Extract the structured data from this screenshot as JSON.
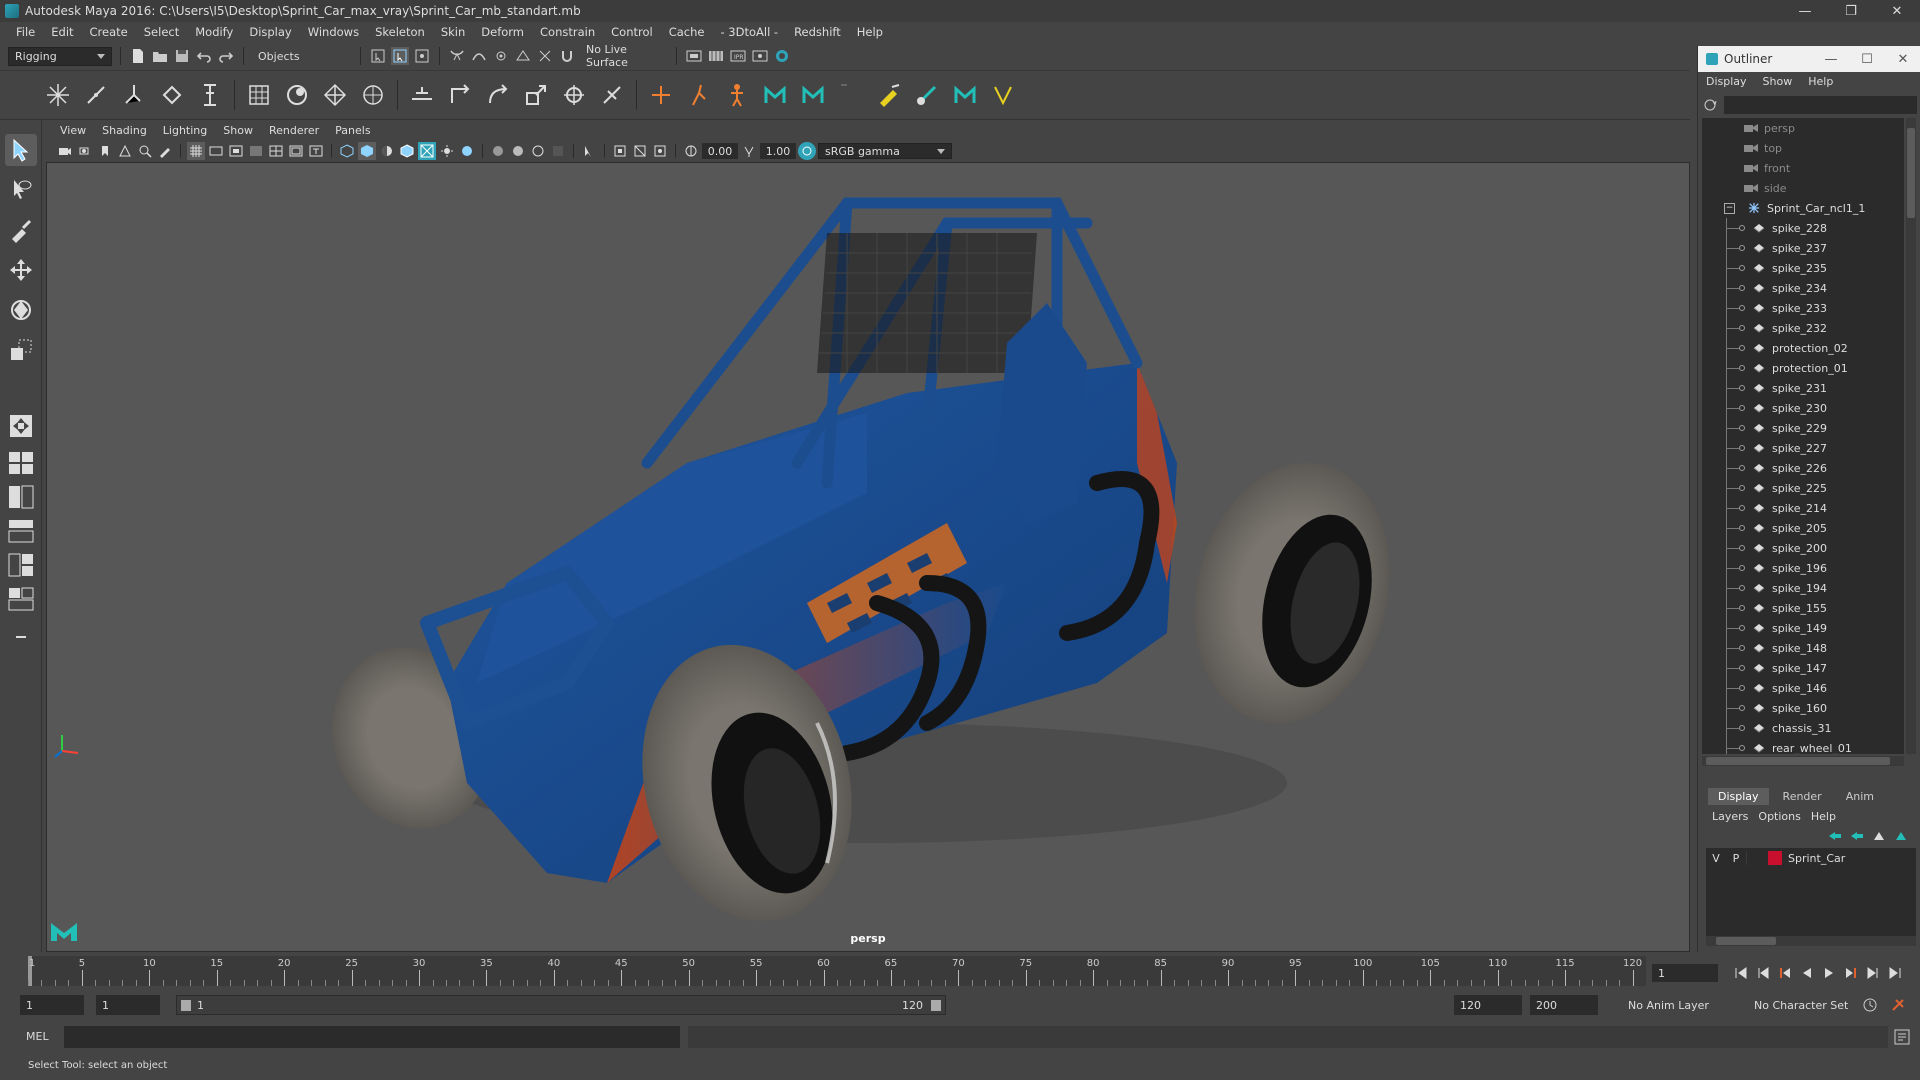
{
  "window": {
    "title": "Autodesk Maya 2016: C:\\Users\\I5\\Desktop\\Sprint_Car_max_vray\\Sprint_Car_mb_standart.mb",
    "minimize": "—",
    "maximize": "❐",
    "close": "✕"
  },
  "menubar": [
    "File",
    "Edit",
    "Create",
    "Select",
    "Modify",
    "Display",
    "Windows",
    "Skeleton",
    "Skin",
    "Deform",
    "Constrain",
    "Control",
    "Cache",
    "- 3DtoAll -",
    "Redshift",
    "Help"
  ],
  "statusline": {
    "menuset": "Rigging",
    "selection_mode": "Objects",
    "live_surface": "No Live Surface"
  },
  "viewport": {
    "menus": [
      "View",
      "Shading",
      "Lighting",
      "Show",
      "Renderer",
      "Panels"
    ],
    "exposure": "0.00",
    "gamma": "1.00",
    "color_space": "sRGB gamma",
    "camera_label": "persp"
  },
  "outliner": {
    "title": "Outliner",
    "menus": [
      "Display",
      "Show",
      "Help"
    ],
    "cameras": [
      "persp",
      "top",
      "front",
      "side"
    ],
    "root": "Sprint_Car_ncl1_1",
    "children": [
      "spike_228",
      "spike_237",
      "spike_235",
      "spike_234",
      "spike_233",
      "spike_232",
      "protection_02",
      "protection_01",
      "spike_231",
      "spike_230",
      "spike_229",
      "spike_227",
      "spike_226",
      "spike_225",
      "spike_214",
      "spike_205",
      "spike_200",
      "spike_196",
      "spike_194",
      "spike_155",
      "spike_149",
      "spike_148",
      "spike_147",
      "spike_146",
      "spike_160",
      "chassis_31",
      "rear_wheel_01"
    ]
  },
  "layer_editor": {
    "tabs": [
      "Display",
      "Render",
      "Anim"
    ],
    "menus": [
      "Layers",
      "Options",
      "Help"
    ],
    "layer": {
      "visible": "V",
      "playback": "P",
      "name": "Sprint_Car",
      "color": "#c8102e"
    }
  },
  "timeline": {
    "ticks": [
      "5",
      "10",
      "15",
      "20",
      "25",
      "30",
      "35",
      "40",
      "45",
      "50",
      "55",
      "60",
      "65",
      "70",
      "75",
      "80",
      "85",
      "90",
      "95",
      "100",
      "105",
      "110",
      "115",
      "120"
    ],
    "first_tick": "1",
    "current_frame": "1"
  },
  "range": {
    "start": "1",
    "playback_start": "1",
    "slider_start": "1",
    "slider_end": "120",
    "playback_end": "120",
    "end": "200",
    "anim_layer": "No Anim Layer",
    "character_set": "No Character Set"
  },
  "commandline": {
    "label": "MEL"
  },
  "helpline": {
    "text": "Select Tool: select an object"
  },
  "colors": {
    "car_body": "#1a4a8c",
    "car_orange": "#c0441a",
    "tire": "#6e6a64",
    "viewport_bg": "#575757"
  }
}
